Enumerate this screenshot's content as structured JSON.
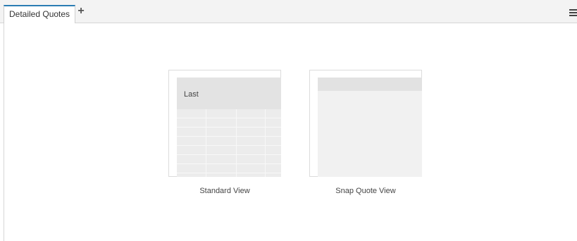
{
  "tabs": [
    {
      "label": "Detailed Quotes",
      "active": true
    }
  ],
  "toolbar": {
    "add_icon": "plus-icon",
    "menu_icon": "hamburger-menu-icon"
  },
  "views": [
    {
      "label": "Standard View",
      "preview_header": "Last"
    },
    {
      "label": "Snap Quote View"
    }
  ],
  "colors": {
    "tab_accent": "#2a7db3",
    "tabbar_bg": "#f3f3f3"
  }
}
